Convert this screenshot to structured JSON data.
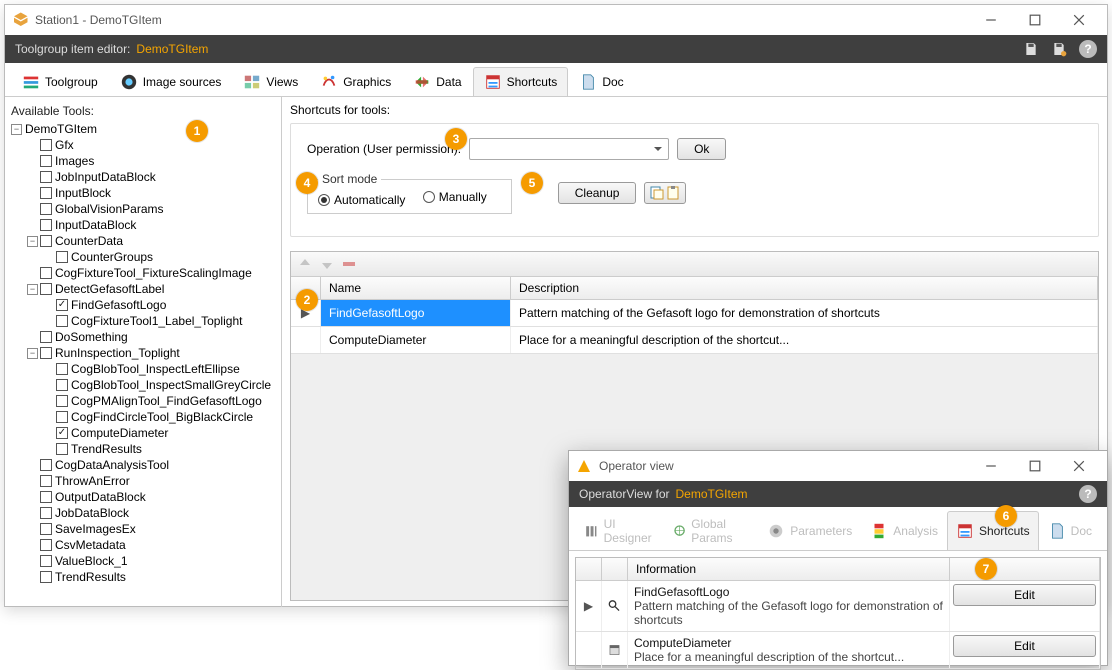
{
  "window1": {
    "title": "Station1 - DemoTGItem",
    "header_label": "Toolgroup item editor:",
    "header_item": "DemoTGItem"
  },
  "tabs": [
    {
      "label": "Toolgroup"
    },
    {
      "label": "Image sources"
    },
    {
      "label": "Views"
    },
    {
      "label": "Graphics"
    },
    {
      "label": "Data"
    },
    {
      "label": "Shortcuts"
    },
    {
      "label": "Doc"
    }
  ],
  "left": {
    "caption": "Available Tools:",
    "root": "DemoTGItem",
    "nodes_top": [
      "Gfx",
      "Images",
      "JobInputDataBlock",
      "InputBlock",
      "GlobalVisionParams",
      "InputDataBlock"
    ],
    "counter": {
      "label": "CounterData",
      "children": [
        "CounterGroups"
      ]
    },
    "cogfix": "CogFixtureTool_FixtureScalingImage",
    "detect": {
      "label": "DetectGefasoftLabel",
      "children": [
        {
          "label": "FindGefasoftLogo",
          "checked": true
        },
        {
          "label": "CogFixtureTool1_Label_Toplight",
          "checked": false
        }
      ]
    },
    "dosomething": "DoSomething",
    "run": {
      "label": "RunInspection_Toplight",
      "children": [
        "CogBlobTool_InspectLeftEllipse",
        "CogBlobTool_InspectSmallGreyCircle",
        "CogPMAlignTool_FindGefasoftLogo",
        "CogFindCircleTool_BigBlackCircle",
        {
          "label": "ComputeDiameter",
          "checked": true
        },
        "TrendResults"
      ]
    },
    "nodes_tail": [
      "CogDataAnalysisTool",
      "ThrowAnError",
      "OutputDataBlock",
      "JobDataBlock",
      "SaveImagesEx",
      "CsvMetadata",
      "ValueBlock_1",
      "TrendResults"
    ]
  },
  "right": {
    "caption": "Shortcuts for tools:",
    "op_label": "Operation (User permission):",
    "ok": "Ok",
    "sort_legend": "Sort mode",
    "sort_auto": "Automatically",
    "sort_manual": "Manually",
    "cleanup": "Cleanup",
    "columns": [
      "",
      "Name",
      "Description"
    ],
    "rows": [
      {
        "name": "FindGefasoftLogo",
        "desc": "Pattern matching of the Gefasoft logo for demonstration of shortcuts",
        "selected": true
      },
      {
        "name": "ComputeDiameter",
        "desc": "Place for a meaningful description of the shortcut...",
        "selected": false
      }
    ]
  },
  "callouts": {
    "1": "1",
    "2": "2",
    "3": "3",
    "4": "4",
    "5": "5",
    "6": "6",
    "7": "7"
  },
  "window2": {
    "title": "Operator view",
    "header_label": "OperatorView for",
    "header_item": "DemoTGItem",
    "tabs": [
      {
        "label": "UI Designer"
      },
      {
        "label": "Global Params"
      },
      {
        "label": "Parameters"
      },
      {
        "label": "Analysis"
      },
      {
        "label": "Shortcuts"
      },
      {
        "label": "Doc"
      }
    ],
    "col_info": "Information",
    "edit": "Edit",
    "rows": [
      {
        "name": "FindGefasoftLogo",
        "desc": "Pattern matching of the Gefasoft logo for demonstration of shortcuts",
        "selected": true
      },
      {
        "name": "ComputeDiameter",
        "desc": "Place for a meaningful description of the shortcut...",
        "selected": false
      }
    ]
  }
}
